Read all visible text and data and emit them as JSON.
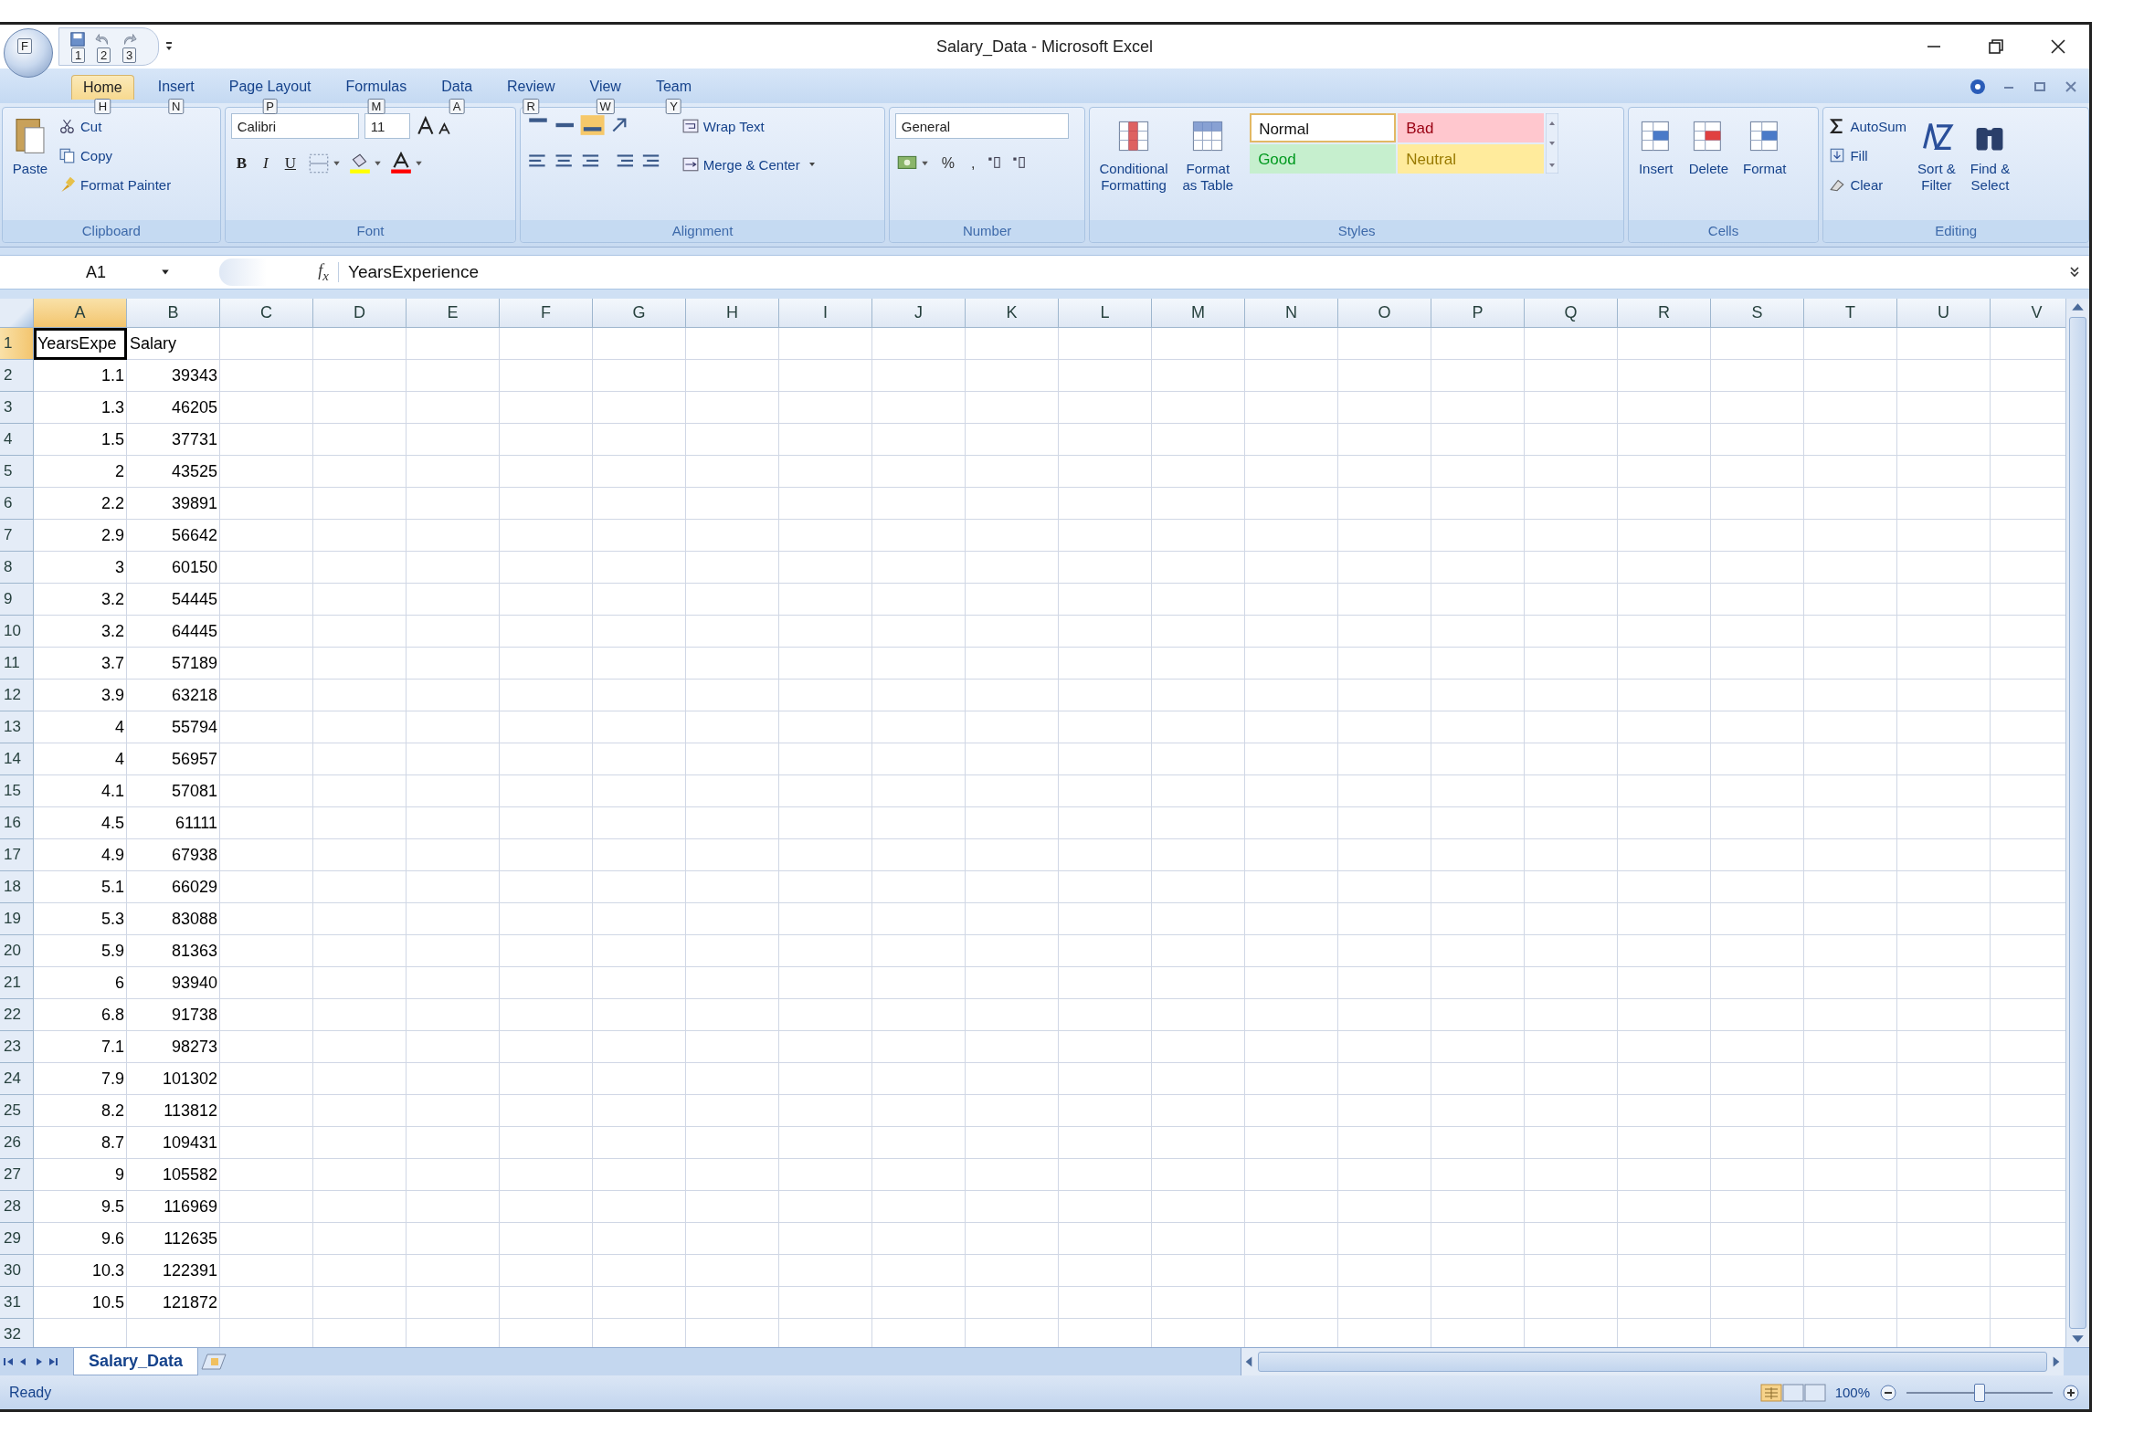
{
  "window": {
    "title": "Salary_Data - Microsoft Excel"
  },
  "quick_access": {
    "office_keytip": "F",
    "keytips": [
      "1",
      "2",
      "3"
    ]
  },
  "tabs": [
    {
      "label": "Home",
      "keytip": "H",
      "selected": true
    },
    {
      "label": "Insert",
      "keytip": "N",
      "selected": false
    },
    {
      "label": "Page Layout",
      "keytip": "P",
      "selected": false
    },
    {
      "label": "Formulas",
      "keytip": "M",
      "selected": false
    },
    {
      "label": "Data",
      "keytip": "A",
      "selected": false
    },
    {
      "label": "Review",
      "keytip": "R",
      "selected": false
    },
    {
      "label": "View",
      "keytip": "W",
      "selected": false
    },
    {
      "label": "Team",
      "keytip": "Y",
      "selected": false
    }
  ],
  "clipboard": {
    "title": "Clipboard",
    "paste": "Paste",
    "cut": "Cut",
    "copy": "Copy",
    "format_painter": "Format Painter"
  },
  "font": {
    "title": "Font",
    "family": "Calibri",
    "size": "11",
    "style_buttons": [
      "B",
      "I",
      "U"
    ]
  },
  "alignment": {
    "title": "Alignment",
    "wrap_text": "Wrap Text",
    "merge_center": "Merge & Center"
  },
  "number": {
    "title": "Number",
    "format": "General",
    "symbols": [
      "%",
      ","
    ]
  },
  "styles": {
    "title": "Styles",
    "commands": [
      {
        "lines": [
          "Conditional",
          "Formatting"
        ]
      },
      {
        "lines": [
          "Format",
          "as Table"
        ]
      }
    ],
    "cell_styles": [
      {
        "label": "Normal",
        "color": "#ffffff",
        "selected": true
      },
      {
        "label": "Bad",
        "color": "#ffc7ce",
        "selected": false
      },
      {
        "label": "Good",
        "color": "#c6efce",
        "selected": false
      },
      {
        "label": "Neutral",
        "color": "#ffeb9c",
        "selected": false
      }
    ]
  },
  "cells": {
    "title": "Cells",
    "commands": [
      "Insert",
      "Delete",
      "Format"
    ]
  },
  "editing": {
    "title": "Editing",
    "commands": [
      "AutoSum",
      "Fill",
      "Clear"
    ],
    "big": [
      {
        "lines": [
          "Sort &",
          "Filter"
        ]
      },
      {
        "lines": [
          "Find &",
          "Select"
        ]
      }
    ]
  },
  "formula_bar": {
    "name_box": "A1",
    "function_label": "f$_{x}$",
    "formula": "YearsExperience"
  },
  "sheet": {
    "columns": [
      {
        "label": "A",
        "selected": true
      },
      {
        "label": "B",
        "selected": false
      },
      {
        "label": "C",
        "selected": false
      },
      {
        "label": "D",
        "selected": false
      },
      {
        "label": "E",
        "selected": false
      },
      {
        "label": "F",
        "selected": false
      },
      {
        "label": "G",
        "selected": false
      },
      {
        "label": "H",
        "selected": false
      },
      {
        "label": "I",
        "selected": false
      },
      {
        "label": "J",
        "selected": false
      },
      {
        "label": "K",
        "selected": false
      },
      {
        "label": "L",
        "selected": false
      },
      {
        "label": "M",
        "selected": false
      },
      {
        "label": "N",
        "selected": false
      },
      {
        "label": "O",
        "selected": false
      },
      {
        "label": "P",
        "selected": false
      },
      {
        "label": "Q",
        "selected": false
      },
      {
        "label": "R",
        "selected": false
      },
      {
        "label": "S",
        "selected": false
      },
      {
        "label": "T",
        "selected": false
      },
      {
        "label": "U",
        "selected": false
      },
      {
        "label": "V",
        "selected": false
      }
    ],
    "rows": [
      {
        "header": "1",
        "kind": "text",
        "selected": true,
        "cells": [
          "YearsExpe",
          "Salary"
        ]
      },
      {
        "header": "2",
        "kind": "number",
        "selected": false,
        "cells": [
          "1.1",
          "39343"
        ]
      },
      {
        "header": "3",
        "kind": "number",
        "selected": false,
        "cells": [
          "1.3",
          "46205"
        ]
      },
      {
        "header": "4",
        "kind": "number",
        "selected": false,
        "cells": [
          "1.5",
          "37731"
        ]
      },
      {
        "header": "5",
        "kind": "number",
        "selected": false,
        "cells": [
          "2",
          "43525"
        ]
      },
      {
        "header": "6",
        "kind": "number",
        "selected": false,
        "cells": [
          "2.2",
          "39891"
        ]
      },
      {
        "header": "7",
        "kind": "number",
        "selected": false,
        "cells": [
          "2.9",
          "56642"
        ]
      },
      {
        "header": "8",
        "kind": "number",
        "selected": false,
        "cells": [
          "3",
          "60150"
        ]
      },
      {
        "header": "9",
        "kind": "number",
        "selected": false,
        "cells": [
          "3.2",
          "54445"
        ]
      },
      {
        "header": "10",
        "kind": "number",
        "selected": false,
        "cells": [
          "3.2",
          "64445"
        ]
      },
      {
        "header": "11",
        "kind": "number",
        "selected": false,
        "cells": [
          "3.7",
          "57189"
        ]
      },
      {
        "header": "12",
        "kind": "number",
        "selected": false,
        "cells": [
          "3.9",
          "63218"
        ]
      },
      {
        "header": "13",
        "kind": "number",
        "selected": false,
        "cells": [
          "4",
          "55794"
        ]
      },
      {
        "header": "14",
        "kind": "number",
        "selected": false,
        "cells": [
          "4",
          "56957"
        ]
      },
      {
        "header": "15",
        "kind": "number",
        "selected": false,
        "cells": [
          "4.1",
          "57081"
        ]
      },
      {
        "header": "16",
        "kind": "number",
        "selected": false,
        "cells": [
          "4.5",
          "61111"
        ]
      },
      {
        "header": "17",
        "kind": "number",
        "selected": false,
        "cells": [
          "4.9",
          "67938"
        ]
      },
      {
        "header": "18",
        "kind": "number",
        "selected": false,
        "cells": [
          "5.1",
          "66029"
        ]
      },
      {
        "header": "19",
        "kind": "number",
        "selected": false,
        "cells": [
          "5.3",
          "83088"
        ]
      },
      {
        "header": "20",
        "kind": "number",
        "selected": false,
        "cells": [
          "5.9",
          "81363"
        ]
      },
      {
        "header": "21",
        "kind": "number",
        "selected": false,
        "cells": [
          "6",
          "93940"
        ]
      },
      {
        "header": "22",
        "kind": "number",
        "selected": false,
        "cells": [
          "6.8",
          "91738"
        ]
      },
      {
        "header": "23",
        "kind": "number",
        "selected": false,
        "cells": [
          "7.1",
          "98273"
        ]
      },
      {
        "header": "24",
        "kind": "number",
        "selected": false,
        "cells": [
          "7.9",
          "101302"
        ]
      },
      {
        "header": "25",
        "kind": "number",
        "selected": false,
        "cells": [
          "8.2",
          "113812"
        ]
      },
      {
        "header": "26",
        "kind": "number",
        "selected": false,
        "cells": [
          "8.7",
          "109431"
        ]
      },
      {
        "header": "27",
        "kind": "number",
        "selected": false,
        "cells": [
          "9",
          "105582"
        ]
      },
      {
        "header": "28",
        "kind": "number",
        "selected": false,
        "cells": [
          "9.5",
          "116969"
        ]
      },
      {
        "header": "29",
        "kind": "number",
        "selected": false,
        "cells": [
          "9.6",
          "112635"
        ]
      },
      {
        "header": "30",
        "kind": "number",
        "selected": false,
        "cells": [
          "10.3",
          "122391"
        ]
      },
      {
        "header": "31",
        "kind": "number",
        "selected": false,
        "cells": [
          "10.5",
          "121872"
        ]
      },
      {
        "header": "32",
        "selected": false,
        "cells": []
      }
    ]
  },
  "sheet_tabs": [
    {
      "label": "Salary_Data",
      "selected": true
    }
  ],
  "status_bar": {
    "status": "Ready",
    "zoom": "100%",
    "zoom_slider": {
      "level": 0.5
    }
  }
}
